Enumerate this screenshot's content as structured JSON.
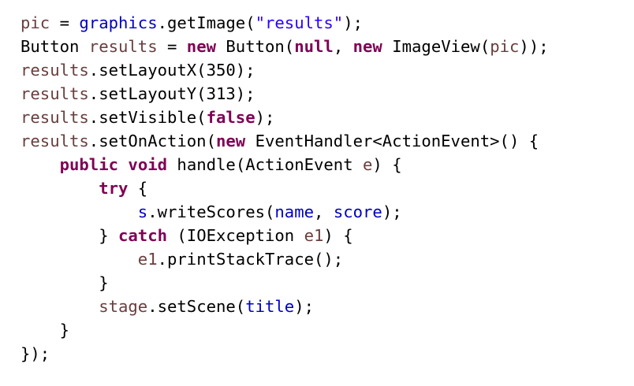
{
  "colors": {
    "background": "#ffffff",
    "plain": "#000000",
    "keyword": "#7f0055",
    "field": "#0000c0",
    "local": "#6a3e3e",
    "string": "#2a00ff"
  },
  "code_lines": [
    [
      {
        "type": "local",
        "text": "pic"
      },
      {
        "type": "plain",
        "text": " = "
      },
      {
        "type": "field",
        "text": "graphics"
      },
      {
        "type": "plain",
        "text": ".getImage("
      },
      {
        "type": "string",
        "text": "\"results\""
      },
      {
        "type": "plain",
        "text": ");"
      }
    ],
    [
      {
        "type": "plain",
        "text": "Button "
      },
      {
        "type": "local",
        "text": "results"
      },
      {
        "type": "plain",
        "text": " = "
      },
      {
        "type": "keyword",
        "text": "new"
      },
      {
        "type": "plain",
        "text": " Button("
      },
      {
        "type": "keyword",
        "text": "null"
      },
      {
        "type": "plain",
        "text": ", "
      },
      {
        "type": "keyword",
        "text": "new"
      },
      {
        "type": "plain",
        "text": " ImageView("
      },
      {
        "type": "local",
        "text": "pic"
      },
      {
        "type": "plain",
        "text": "));"
      }
    ],
    [
      {
        "type": "local",
        "text": "results"
      },
      {
        "type": "plain",
        "text": ".setLayoutX(350);"
      }
    ],
    [
      {
        "type": "local",
        "text": "results"
      },
      {
        "type": "plain",
        "text": ".setLayoutY(313);"
      }
    ],
    [
      {
        "type": "local",
        "text": "results"
      },
      {
        "type": "plain",
        "text": ".setVisible("
      },
      {
        "type": "keyword",
        "text": "false"
      },
      {
        "type": "plain",
        "text": ");"
      }
    ],
    [
      {
        "type": "local",
        "text": "results"
      },
      {
        "type": "plain",
        "text": ".setOnAction("
      },
      {
        "type": "keyword",
        "text": "new"
      },
      {
        "type": "plain",
        "text": " EventHandler<ActionEvent>() {"
      }
    ],
    [
      {
        "type": "plain",
        "text": "    "
      },
      {
        "type": "keyword",
        "text": "public"
      },
      {
        "type": "plain",
        "text": " "
      },
      {
        "type": "keyword",
        "text": "void"
      },
      {
        "type": "plain",
        "text": " handle(ActionEvent "
      },
      {
        "type": "local",
        "text": "e"
      },
      {
        "type": "plain",
        "text": ") {"
      }
    ],
    [
      {
        "type": "plain",
        "text": "        "
      },
      {
        "type": "keyword",
        "text": "try"
      },
      {
        "type": "plain",
        "text": " {"
      }
    ],
    [
      {
        "type": "plain",
        "text": "            "
      },
      {
        "type": "field",
        "text": "s"
      },
      {
        "type": "plain",
        "text": ".writeScores("
      },
      {
        "type": "field",
        "text": "name"
      },
      {
        "type": "plain",
        "text": ", "
      },
      {
        "type": "field",
        "text": "score"
      },
      {
        "type": "plain",
        "text": ");"
      }
    ],
    [
      {
        "type": "plain",
        "text": "        } "
      },
      {
        "type": "keyword",
        "text": "catch"
      },
      {
        "type": "plain",
        "text": " (IOException "
      },
      {
        "type": "local",
        "text": "e1"
      },
      {
        "type": "plain",
        "text": ") {"
      }
    ],
    [
      {
        "type": "plain",
        "text": "            "
      },
      {
        "type": "local",
        "text": "e1"
      },
      {
        "type": "plain",
        "text": ".printStackTrace();"
      }
    ],
    [
      {
        "type": "plain",
        "text": "        }"
      }
    ],
    [
      {
        "type": "plain",
        "text": "        "
      },
      {
        "type": "local",
        "text": "stage"
      },
      {
        "type": "plain",
        "text": ".setScene("
      },
      {
        "type": "field",
        "text": "title"
      },
      {
        "type": "plain",
        "text": ");"
      }
    ],
    [
      {
        "type": "plain",
        "text": "    }"
      }
    ],
    [
      {
        "type": "plain",
        "text": "});"
      }
    ]
  ]
}
